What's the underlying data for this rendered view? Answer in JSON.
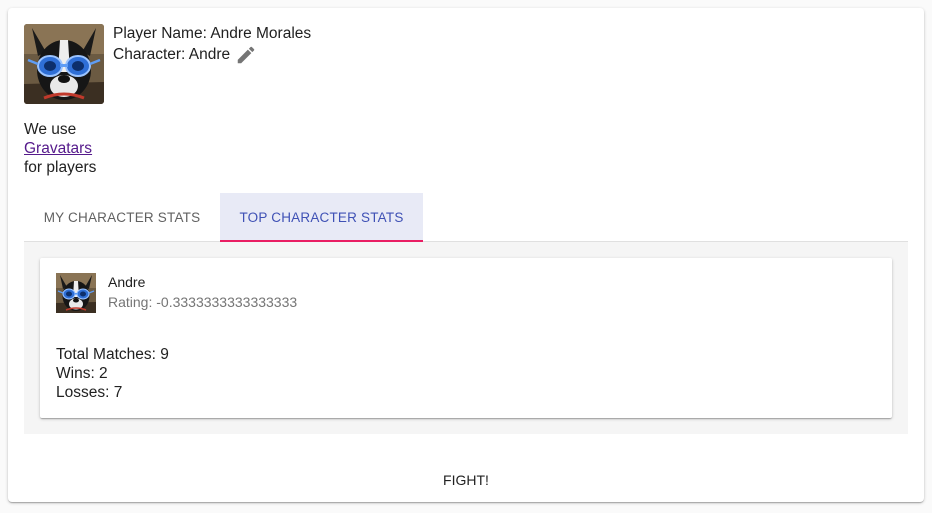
{
  "player": {
    "name_text": "Player Name: Andre Morales",
    "character_label": "Character: Andre",
    "edit_icon": "pencil-icon",
    "avatar_icon": "dog-with-blue-goggles-avatar"
  },
  "gravatar_note": {
    "prefix": "We use",
    "link_text": "Gravatars",
    "suffix": "for players"
  },
  "tabs": [
    {
      "label": "MY CHARACTER STATS",
      "selected": false
    },
    {
      "label": "TOP CHARACTER STATS",
      "selected": true
    }
  ],
  "top_stats": {
    "character_name": "Andre",
    "rating": "Rating: -0.3333333333333333",
    "total_matches": "Total Matches: 9",
    "wins": "Wins: 2",
    "losses": "Losses: 7"
  },
  "actions": {
    "fight_label": "FIGHT!"
  },
  "colors": {
    "tab_active_text": "#3f51b5",
    "tab_active_bg": "#e8eaf6",
    "tab_indicator": "#e91e63",
    "link": "#551a8b"
  }
}
